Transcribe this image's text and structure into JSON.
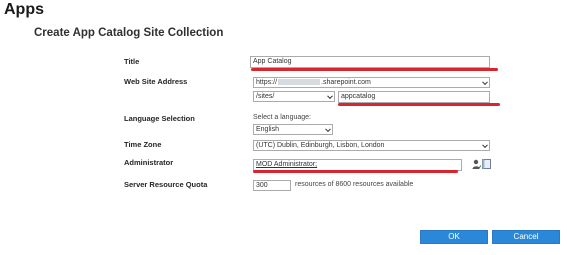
{
  "app": {
    "title": "Apps"
  },
  "page": {
    "title": "Create App Catalog Site Collection"
  },
  "form": {
    "title": {
      "label": "Title",
      "value": "App Catalog"
    },
    "web_site_address": {
      "label": "Web Site Address",
      "domain_prefix": "https://",
      "domain_suffix": ".sharepoint.com",
      "path_selected": "/sites/",
      "url_value": "appcatalog"
    },
    "language": {
      "label": "Language Selection",
      "hint": "Select a language:",
      "selected": "English"
    },
    "time_zone": {
      "label": "Time Zone",
      "selected": "(UTC) Dublin, Edinburgh, Lisbon, London"
    },
    "administrator": {
      "label": "Administrator",
      "value": "MOD Administrator;"
    },
    "quota": {
      "label": "Server Resource Quota",
      "value": "300",
      "suffix": "resources of 8600 resources available"
    }
  },
  "buttons": {
    "ok": "OK",
    "cancel": "Cancel"
  },
  "colors": {
    "accent": "#2b88d8",
    "highlight": "#d9262e"
  }
}
